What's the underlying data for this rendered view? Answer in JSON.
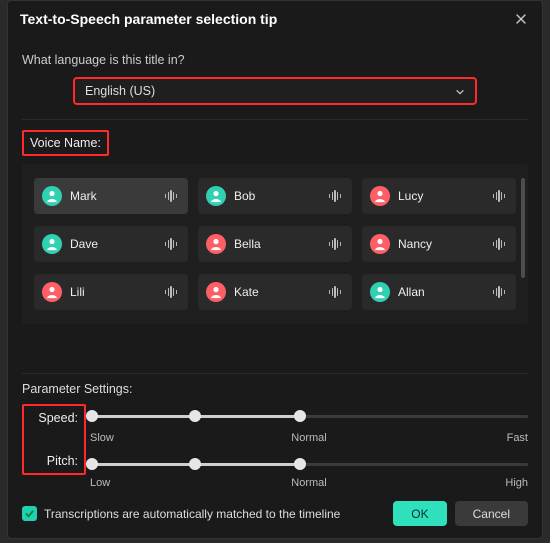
{
  "modal": {
    "title": "Text-to-Speech parameter selection tip",
    "prompt": "What language is this title in?"
  },
  "language": {
    "selected": "English (US)"
  },
  "voice": {
    "label": "Voice Name:",
    "items": [
      {
        "name": "Mark",
        "avatar_bg": "#2fd1b2",
        "selected": true
      },
      {
        "name": "Bob",
        "avatar_bg": "#2fd1b2",
        "selected": false
      },
      {
        "name": "Lucy",
        "avatar_bg": "#ff5e66",
        "selected": false
      },
      {
        "name": "Dave",
        "avatar_bg": "#2fd1b2",
        "selected": false
      },
      {
        "name": "Bella",
        "avatar_bg": "#ff5e66",
        "selected": false
      },
      {
        "name": "Nancy",
        "avatar_bg": "#ff5e66",
        "selected": false
      },
      {
        "name": "Lili",
        "avatar_bg": "#ff5e66",
        "selected": false
      },
      {
        "name": "Kate",
        "avatar_bg": "#ff5e66",
        "selected": false
      },
      {
        "name": "Allan",
        "avatar_bg": "#2fd1b2",
        "selected": false
      }
    ]
  },
  "params": {
    "title": "Parameter Settings:",
    "speed": {
      "label": "Speed:",
      "min_label": "Slow",
      "mid_label": "Normal",
      "max_label": "Fast",
      "value_pct": 48,
      "knobs_pct": [
        0.5,
        24,
        48
      ]
    },
    "pitch": {
      "label": "Pitch:",
      "min_label": "Low",
      "mid_label": "Normal",
      "max_label": "High",
      "value_pct": 48,
      "knobs_pct": [
        0.5,
        24,
        48
      ]
    }
  },
  "footer": {
    "checkbox_checked": true,
    "checkbox_label": "Transcriptions are automatically matched to the timeline",
    "ok": "OK",
    "cancel": "Cancel"
  },
  "colors": {
    "highlight": "#ff2a2a",
    "accent": "#2fe0bd"
  }
}
